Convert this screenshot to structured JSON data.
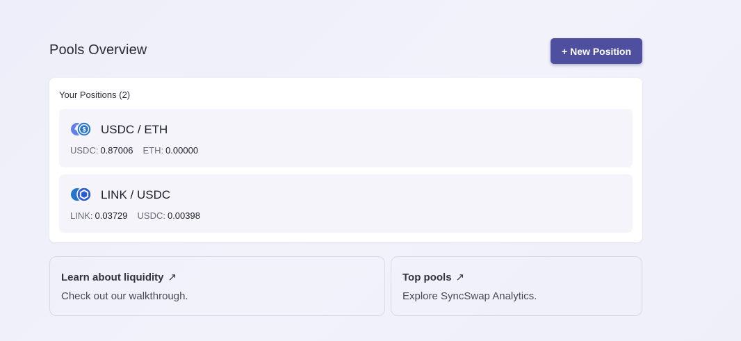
{
  "header": {
    "title": "Pools Overview",
    "new_position_plus": "+",
    "new_position_label": "New Position"
  },
  "positions": {
    "title": "Your Positions (2)",
    "items": [
      {
        "pair": "USDC / ETH",
        "icon": "usdc-eth-pair-icon",
        "amounts": [
          {
            "label": "USDC:",
            "value": "0.87006"
          },
          {
            "label": "ETH:",
            "value": "0.00000"
          }
        ]
      },
      {
        "pair": "LINK / USDC",
        "icon": "link-usdc-pair-icon",
        "amounts": [
          {
            "label": "LINK:",
            "value": "0.03729"
          },
          {
            "label": "USDC:",
            "value": "0.00398"
          }
        ]
      }
    ]
  },
  "links": [
    {
      "title": "Learn about liquidity",
      "arrow": "↗",
      "description": "Check out our walkthrough."
    },
    {
      "title": "Top pools",
      "arrow": "↗",
      "description": "Explore SyncSwap Analytics."
    }
  ],
  "colors": {
    "accent": "#4f4f9f",
    "usdc_blue": "#2775ca",
    "eth_purple": "#627eea",
    "link_blue": "#2a5ada"
  }
}
